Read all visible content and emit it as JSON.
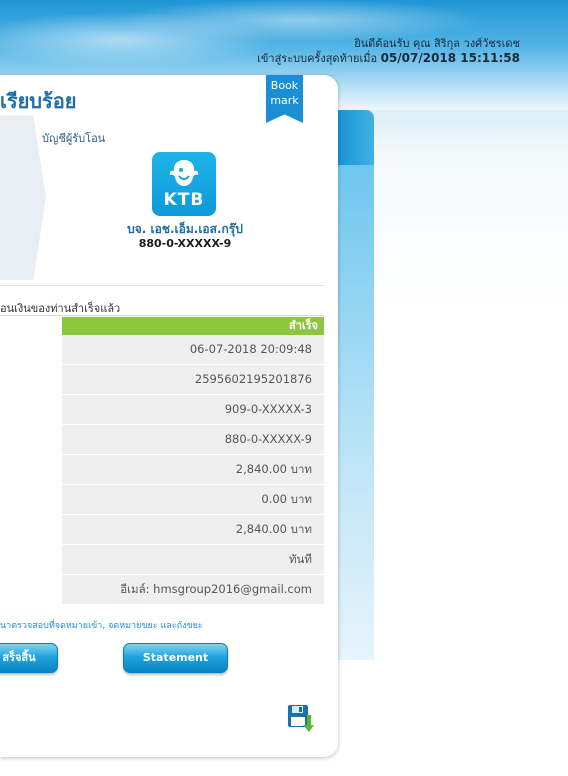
{
  "header": {
    "welcome": "ยินดีต้อนรับ คุณ สิริกุล วงศ์วัชรเดช",
    "last_login_label": "เข้าสู่ระบบครั้งสุดท้ายเมื่อ",
    "last_login_value": "05/07/2018 15:11:58"
  },
  "panel": {
    "title": "เรียบร้อย",
    "bookmark_line1": "Book",
    "bookmark_line2": "mark"
  },
  "recipient": {
    "label": "บัญชีผู้รับโอน",
    "bank_logo_text": "KTB",
    "bank_icon": "ktb-bird-icon",
    "name": "บจ. เอช.เอ็ม.เอส.กรุ๊ป",
    "account": "880-0-XXXXX-9"
  },
  "result": {
    "message": "อนเงินของท่านสำเร็จแล้ว",
    "status": "สำเร็จ",
    "rows": [
      "06-07-2018 20:09:48",
      "2595602195201876",
      "909-0-XXXXX-3",
      "880-0-XXXXX-9",
      "2,840.00 บาท",
      "0.00 บาท",
      "2,840.00 บาท",
      "ทันที",
      "อีเมล์: hmsgroup2016@gmail.com"
    ]
  },
  "footer": {
    "note": "นาตรวจสอบที่จดหมายเข้า, จดหมายขยะ และถังขยะ",
    "finish_button": "สร็จสิ้น",
    "statement_button": "Statement",
    "save_icon": "save-download-icon"
  },
  "colors": {
    "accent": "#1a8fd6",
    "success": "#8dc63f"
  }
}
